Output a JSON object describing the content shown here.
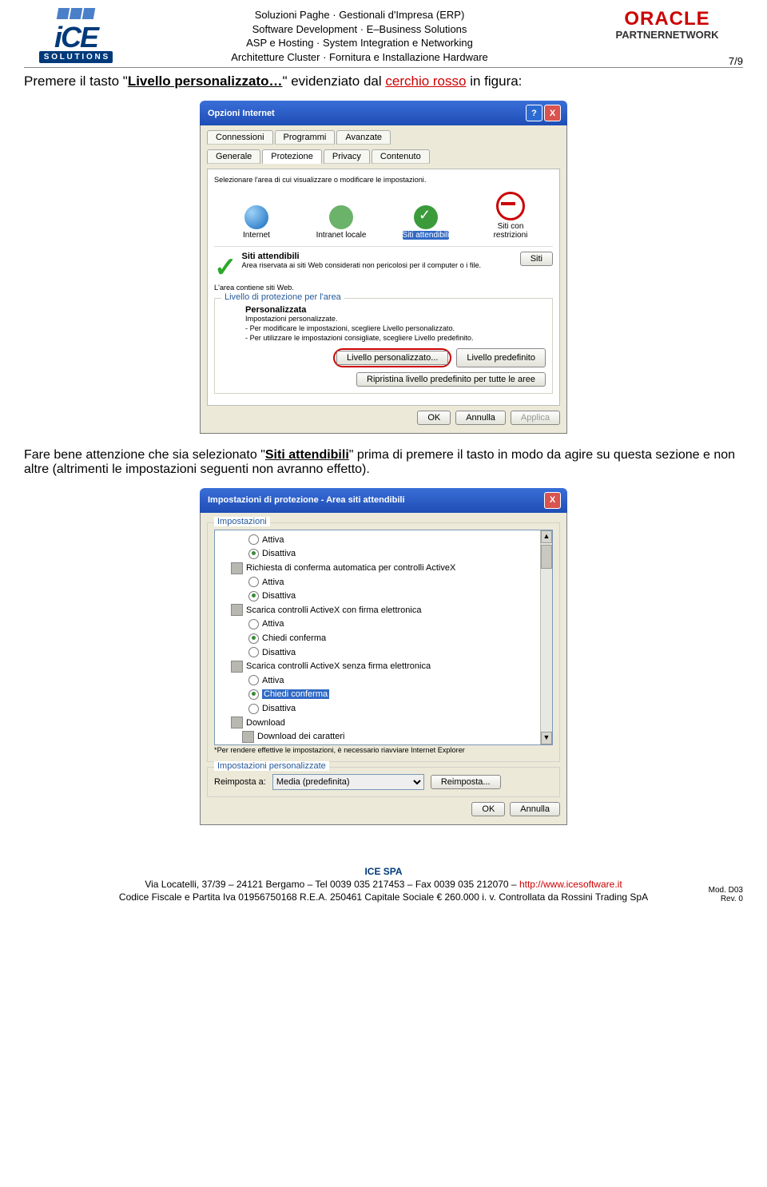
{
  "header": {
    "lines": [
      "Soluzioni Paghe · Gestionali d'Impresa (ERP)",
      "Software Development  ·  E–Business Solutions",
      "ASP e Hosting  ·  System Integration e Networking",
      "Architetture Cluster · Fornitura e Installazione Hardware"
    ],
    "oracle": "ORACLE",
    "partner": "PARTNERNETWORK",
    "page": "7/9",
    "ice_big": "iCE",
    "ice_sol": "S O L U T I O N S"
  },
  "instr": {
    "pre": "Premere  il tasto \"",
    "btn": "Livello personalizzato…",
    "mid": "\" evidenziato dal ",
    "red": "cerchio rosso",
    "post": " in figura:"
  },
  "d1": {
    "title": "Opzioni Internet",
    "tabs_top": [
      "Connessioni",
      "Programmi",
      "Avanzate"
    ],
    "tabs_bot": [
      "Generale",
      "Protezione",
      "Privacy",
      "Contenuto"
    ],
    "zone_label": "Selezionare l'area di cui visualizzare o modificare le impostazioni.",
    "zones": [
      "Internet",
      "Intranet locale",
      "Siti attendibili",
      "Siti con restrizioni"
    ],
    "attend_title": "Siti attendibili",
    "attend_desc": "Area riservata ai siti Web considerati non pericolosi per il computer o i file.",
    "attend_contains": "L'area contiene siti Web.",
    "siti_btn": "Siti",
    "level_legend": "Livello di protezione per l'area",
    "pers_title": "Personalizzata",
    "pers_l1": "Impostazioni personalizzate.",
    "pers_l2": "- Per modificare le impostazioni, scegliere Livello personalizzato.",
    "pers_l3": "- Per utilizzare le impostazioni consigliate, scegliere Livello predefinito.",
    "btn_custom": "Livello personalizzato...",
    "btn_default": "Livello predefinito",
    "btn_reset": "Ripristina livello predefinito per tutte le aree",
    "ok": "OK",
    "cancel": "Annulla",
    "apply": "Applica"
  },
  "mid": {
    "p1": "Fare bene attenzione che sia selezionato \"",
    "u": "Siti attendibili",
    "p2": "\" prima di premere il tasto in modo da agire su questa sezione e non altre (altrimenti le impostazioni seguenti non avranno effetto)."
  },
  "d2": {
    "title": "Impostazioni di protezione - Area siti attendibili",
    "legend": "Impostazioni",
    "opt_att": "Attiva",
    "opt_dis": "Disattiva",
    "opt_chi": "Chiedi conferma",
    "row1": "Richiesta di conferma automatica per controlli ActiveX",
    "row2": "Scarica controlli ActiveX con firma elettronica",
    "row3": "Scarica controlli ActiveX senza firma elettronica",
    "row4": "Download",
    "row5": "Download dei caratteri",
    "note": "*Per rendere effettive le impostazioni, è necessario riavviare Internet Explorer",
    "legend2": "Impostazioni personalizzate",
    "reset_to": "Reimposta a:",
    "reset_val": "Media (predefinita)",
    "reset_btn": "Reimposta...",
    "ok": "OK",
    "cancel": "Annulla"
  },
  "footer": {
    "name": "ICE SPA",
    "addr1": "Via Locatelli, 37/39  –  24121 Bergamo  –  Tel  0039  035  217453  –  Fax  0039  035  212070  –  ",
    "url": "http://www.icesoftware.it",
    "addr2": "Codice Fiscale e Partita Iva 01956750168   R.E.A. 250461 Capitale Sociale € 260.000  i. v. Controllata da Rossini Trading SpA",
    "mod": "Mod. D03",
    "rev": "Rev. 0"
  }
}
